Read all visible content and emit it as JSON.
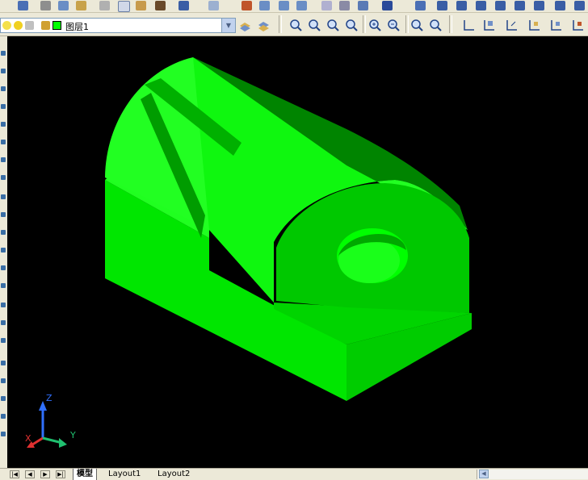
{
  "layer": {
    "current_name": "图层1"
  },
  "tabs": [
    {
      "label": "模型"
    },
    {
      "label": "Layout1"
    },
    {
      "label": "Layout2"
    }
  ],
  "ucs": {
    "x_label": "X",
    "y_label": "Y",
    "z_label": "Z"
  },
  "colors": {
    "model_green": "#00ff00",
    "viewport_bg": "#000000",
    "x_axis": "#e03030",
    "y_axis": "#20c070",
    "z_axis": "#3070ff"
  },
  "icons": {
    "top_toolbar": [
      "save-icon",
      "plot-icon",
      "plot-preview-icon",
      "publish-icon",
      "cut-icon",
      "copy-icon",
      "paste-icon",
      "match-properties-icon",
      "undo-icon",
      "redo-icon",
      "pan-icon",
      "zoom-realtime-icon",
      "zoom-window-icon",
      "zoom-previous-icon",
      "properties-icon",
      "design-center-icon",
      "tool-palettes-icon",
      "help-icon",
      "view-icon",
      "top-view-icon",
      "bottom-view-icon",
      "left-view-icon",
      "right-view-icon",
      "front-view-icon",
      "back-view-icon",
      "iso-view-icon"
    ],
    "zoom_toolbar": [
      "zoom-window-icon",
      "zoom-dynamic-icon",
      "zoom-scale-icon",
      "zoom-center-icon",
      "zoom-in-icon",
      "zoom-out-icon",
      "zoom-all-icon",
      "zoom-extents-icon"
    ],
    "ucs_toolbar": [
      "ucs-icon",
      "ucs-world-icon",
      "ucs-previous-icon",
      "ucs-face-icon",
      "ucs-object-icon",
      "ucs-view-icon"
    ]
  }
}
